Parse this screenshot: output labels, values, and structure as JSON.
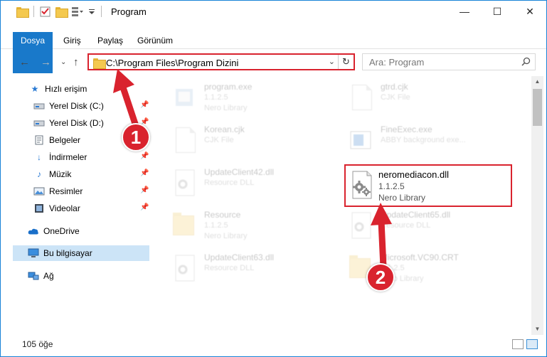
{
  "window": {
    "title": "Program",
    "controls": {
      "minimize": "—",
      "maximize": "☐",
      "close": "✕"
    }
  },
  "ribbon": {
    "tabs": [
      "Dosya",
      "Giriş",
      "Paylaş",
      "Görünüm"
    ]
  },
  "address": {
    "path": "C:\\Program Files\\Program Dizini",
    "refresh_icon": "refresh-icon"
  },
  "search": {
    "placeholder": "Ara: Program"
  },
  "sidebar": {
    "items": [
      {
        "label": "Hızlı erişim",
        "icon": "star-icon",
        "pinned": false
      },
      {
        "label": "Yerel Disk (C:)",
        "icon": "drive-icon",
        "pinned": true
      },
      {
        "label": "Yerel Disk (D:)",
        "icon": "drive-icon",
        "pinned": true
      },
      {
        "label": "Belgeler",
        "icon": "documents-icon",
        "pinned": true
      },
      {
        "label": "İndirmeler",
        "icon": "downloads-icon",
        "pinned": true
      },
      {
        "label": "Müzik",
        "icon": "music-icon",
        "pinned": true
      },
      {
        "label": "Resimler",
        "icon": "pictures-icon",
        "pinned": true
      },
      {
        "label": "Videolar",
        "icon": "videos-icon",
        "pinned": true
      },
      {
        "label": "OneDrive",
        "icon": "cloud-icon",
        "pinned": false
      },
      {
        "label": "Bu bilgisayar",
        "icon": "computer-icon",
        "pinned": false,
        "selected": true
      },
      {
        "label": "Ağ",
        "icon": "network-icon",
        "pinned": false
      }
    ]
  },
  "files": [
    {
      "name": "program.exe",
      "line2": "1.1.2.5",
      "line3": "Nero Library",
      "kind": "app"
    },
    {
      "name": "gtrd.cjk",
      "line2": "CJK File",
      "line3": "",
      "kind": "doc"
    },
    {
      "name": "Korean.cjk",
      "line2": "CJK File",
      "line3": "",
      "kind": "doc"
    },
    {
      "name": "FineExec.exe",
      "line2": "ABBY background exe...",
      "line3": "",
      "kind": "app"
    },
    {
      "name": "UpdateClient42.dll",
      "line2": "Resource DLL",
      "line3": "",
      "kind": "dll"
    },
    {
      "name": "neromediacon.dll",
      "line2": "1.1.2.5",
      "line3": "Nero Library",
      "kind": "dll",
      "highlighted": true
    },
    {
      "name": "Resource",
      "line2": "1.1.2.5",
      "line3": "Nero Library",
      "kind": "folder"
    },
    {
      "name": "UpdateClient65.dll",
      "line2": "Resource DLL",
      "line3": "",
      "kind": "dll"
    },
    {
      "name": "UpdateClient63.dll",
      "line2": "Resource DLL",
      "line3": "",
      "kind": "dll"
    },
    {
      "name": "Microsoft.VC90.CRT",
      "line2": "1.1.2.5",
      "line3": "Nero Library",
      "kind": "folder"
    }
  ],
  "status": {
    "count": "105 öğe"
  },
  "callouts": {
    "one": "1",
    "two": "2"
  },
  "colors": {
    "accent": "#1979ca",
    "highlight": "#d9232e",
    "selected": "#cce4f7"
  }
}
